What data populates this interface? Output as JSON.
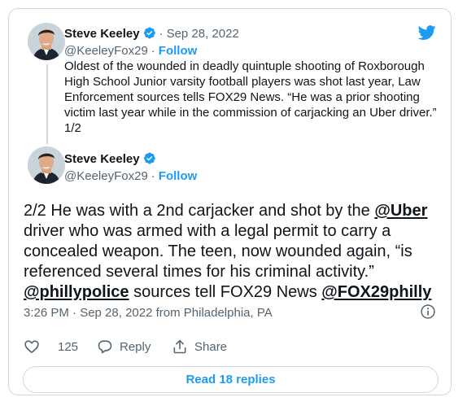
{
  "colors": {
    "accent": "#1d9bf0",
    "muted": "#536471",
    "text": "#0f1419",
    "border": "#cfd9de"
  },
  "icons": {
    "logo": "twitter-bird-icon",
    "verified": "verified-badge-icon",
    "info": "info-icon",
    "like": "heart-icon",
    "reply": "reply-bubble-icon",
    "share": "share-icon"
  },
  "quoted_tweet": {
    "author_name": "Steve Keeley",
    "separator": "·",
    "date": "Sep 28, 2022",
    "handle": "@KeeleyFox29",
    "follow_sep": "·",
    "follow_label": "Follow",
    "text": "Oldest of the wounded in deadly quintuple shooting of Roxborough High School Junior varsity football players was shot last year, Law Enforcement sources tells FOX29 News.   “He was a prior shooting victim last year while in the commission of carjacking an Uber driver.” 1/2"
  },
  "tweet": {
    "author_name": "Steve Keeley",
    "handle": "@KeeleyFox29",
    "follow_sep": "·",
    "follow_label": "Follow",
    "text_part1": "2/2 He was with a 2nd carjacker and shot by  the ",
    "mention_uber": "@Uber",
    "text_part2": " driver who was armed with a legal permit to carry a concealed weapon.   The teen, now wounded again,  “is referenced several times for his criminal activity.” ",
    "mention_police": "@phillypolice",
    "text_part3": " sources tell FOX29 News ",
    "mention_fox": "@FOX29philly",
    "timestamp": "3:26 PM · Sep 28, 2022 from Philadelphia, PA",
    "likes": "125",
    "reply_label": "Reply",
    "share_label": "Share",
    "read_replies_label": "Read 18 replies"
  }
}
